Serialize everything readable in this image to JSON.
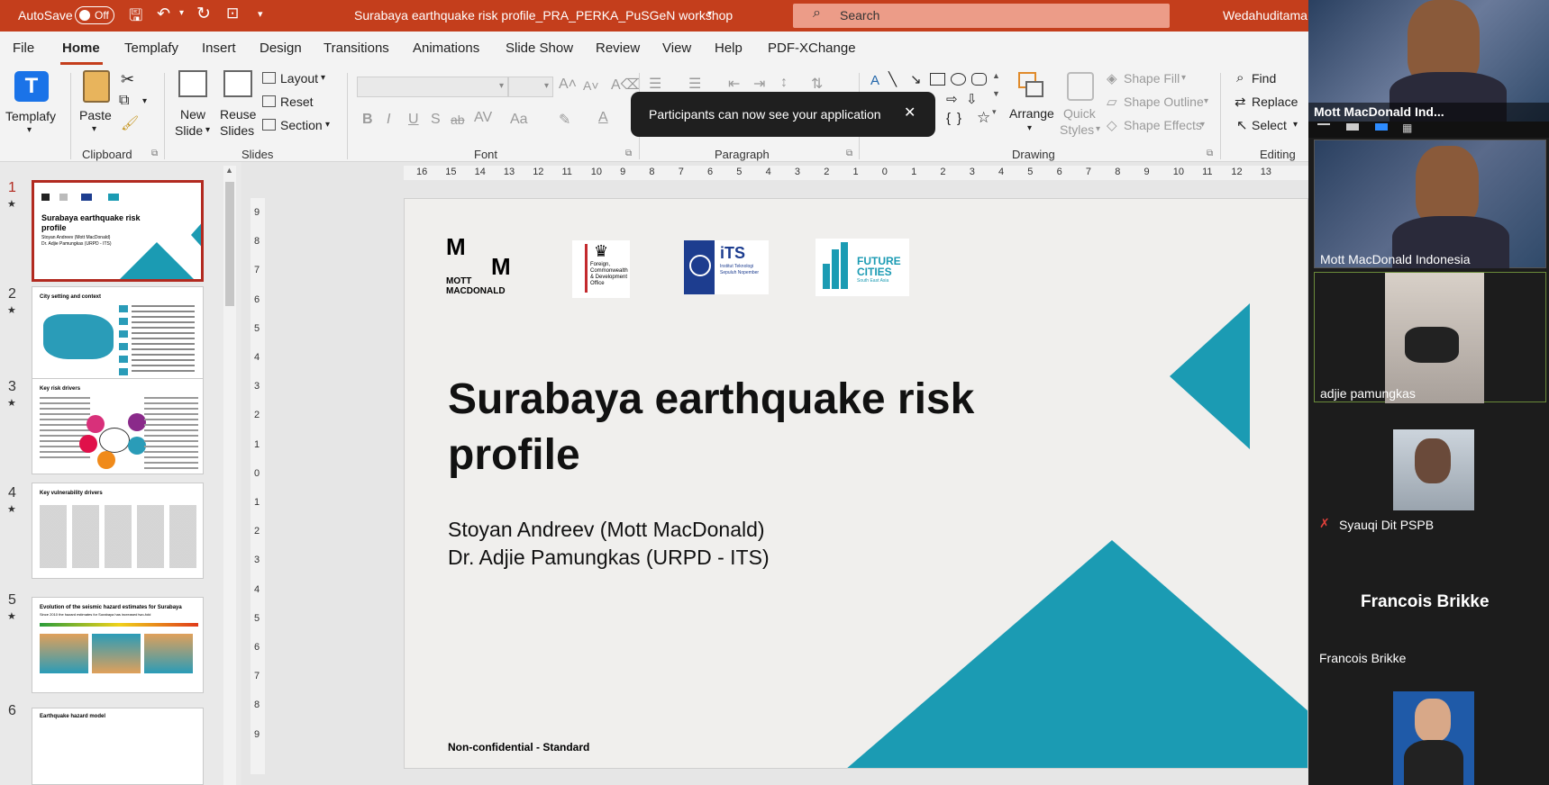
{
  "titlebar": {
    "autosave": "AutoSave",
    "toggle": "Off",
    "doc_title": "Surabaya earthquake risk profile_PRA_PERKA_PuSGeN workshop",
    "search_placeholder": "Search",
    "user": "Wedahuditama,"
  },
  "tabs": [
    "File",
    "Home",
    "Templafy",
    "Insert",
    "Design",
    "Transitions",
    "Animations",
    "Slide Show",
    "Review",
    "View",
    "Help",
    "PDF-XChange"
  ],
  "ribbon": {
    "templafy": "Templafy",
    "clipboard": {
      "paste": "Paste",
      "label": "Clipboard"
    },
    "slides": {
      "new_slide_1": "New",
      "new_slide_2": "Slide",
      "reuse_1": "Reuse",
      "reuse_2": "Slides",
      "layout": "Layout",
      "reset": "Reset",
      "section": "Section",
      "label": "Slides"
    },
    "font": {
      "bold": "B",
      "italic": "I",
      "underline": "U",
      "shadow": "S",
      "strike": "ab",
      "label": "Font"
    },
    "paragraph": {
      "label": "Paragraph"
    },
    "drawing": {
      "arrange": "Arrange",
      "quick_1": "Quick",
      "quick_2": "Styles",
      "shape_fill": "Shape Fill",
      "shape_outline": "Shape Outline",
      "shape_effects": "Shape Effects",
      "label": "Drawing"
    },
    "editing": {
      "find": "Find",
      "replace": "Replace",
      "select": "Select",
      "label": "Editing"
    }
  },
  "toast": "Participants can now see your application",
  "ruler_h": [
    "16",
    "15",
    "14",
    "13",
    "12",
    "11",
    "10",
    "9",
    "8",
    "7",
    "6",
    "5",
    "4",
    "3",
    "2",
    "1",
    "0",
    "1",
    "2",
    "3",
    "4",
    "5",
    "6",
    "7",
    "8",
    "9",
    "10",
    "11",
    "12",
    "13"
  ],
  "ruler_v": [
    "9",
    "8",
    "7",
    "6",
    "5",
    "4",
    "3",
    "2",
    "1",
    "0",
    "1",
    "2",
    "3",
    "4",
    "5",
    "6",
    "7",
    "8",
    "9"
  ],
  "thumbnails": [
    {
      "num": "1",
      "title": "Surabaya earthquake risk profile",
      "sub": "Stoyan Andreev (Mott MacDonald)\nDr. Adjie Pamungkas (URPD - ITS)"
    },
    {
      "num": "2",
      "title": "City setting and context"
    },
    {
      "num": "3",
      "title": "Key risk drivers"
    },
    {
      "num": "4",
      "title": "Key vulnerability drivers"
    },
    {
      "num": "5",
      "title": "Evolution of the seismic hazard estimates for Surabaya",
      "sub": "Since 2010 the hazard estimates for Surabaya has increased two-fold"
    },
    {
      "num": "6",
      "title": "Earthquake hazard model"
    }
  ],
  "slide": {
    "logo_mm_1": "M",
    "logo_mm_2": "M",
    "logo_mm_text_1": "MOTT",
    "logo_mm_text_2": "MACDONALD",
    "logo_fcdo": "Foreign, Commonwealth & Development Office",
    "logo_its_1": "iTS",
    "logo_its_2": "Institut Teknologi Sepuluh Nopember",
    "logo_fc_1": "FUTURE",
    "logo_fc_2": "CITIES",
    "logo_fc_3": "South East Asia",
    "title_line1": "Surabaya earthquake risk",
    "title_line2": "profile",
    "author1": "Stoyan Andreev (Mott MacDonald)",
    "author2": "Dr. Adjie Pamungkas (URPD - ITS)",
    "footer": "Non-confidential - Standard"
  },
  "video": {
    "p1": "Mott MacDonald Ind...",
    "p2": "Mott MacDonald Indonesia",
    "p3": "adjie pamungkas",
    "p4": "Syauqi Dit PSPB",
    "p5_big": "Francois Brikke",
    "p5": "Francois Brikke"
  },
  "colors": {
    "titlebar": "#c43e1c",
    "accent": "#1b9bb3",
    "selected": "#b22a20"
  }
}
